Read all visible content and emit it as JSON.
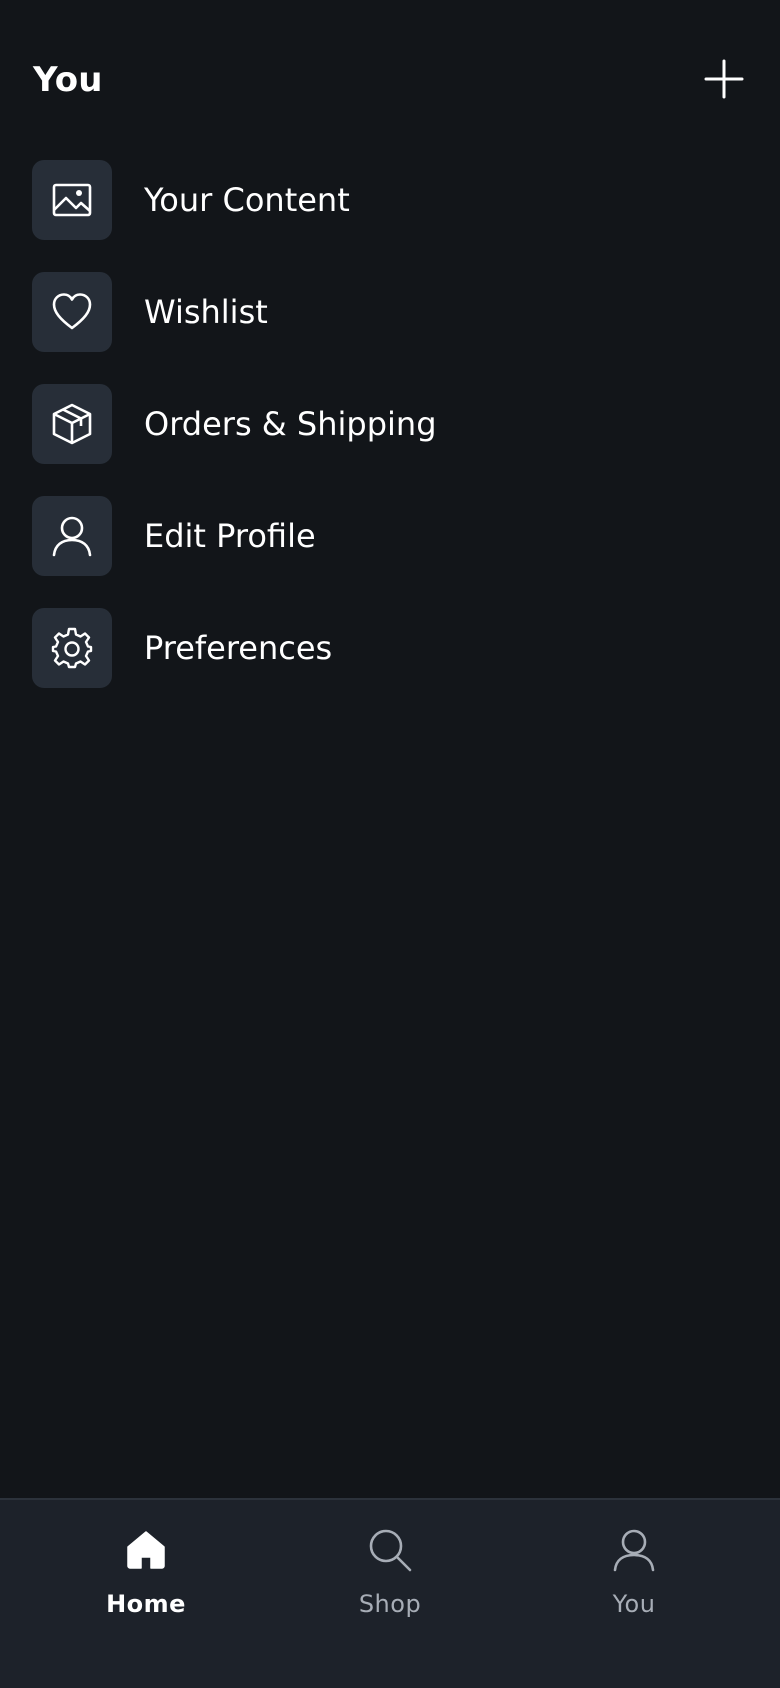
{
  "header": {
    "title": "You",
    "add_icon": "plus-icon"
  },
  "menu": {
    "items": [
      {
        "label": "Your Content",
        "icon": "image-icon"
      },
      {
        "label": "Wishlist",
        "icon": "heart-icon"
      },
      {
        "label": "Orders & Shipping",
        "icon": "package-icon"
      },
      {
        "label": "Edit Profile",
        "icon": "user-icon"
      },
      {
        "label": "Preferences",
        "icon": "gear-icon"
      }
    ]
  },
  "bottom_nav": {
    "tabs": [
      {
        "label": "Home",
        "icon": "home-icon",
        "active": true
      },
      {
        "label": "Shop",
        "icon": "search-icon",
        "active": false
      },
      {
        "label": "You",
        "icon": "user-icon",
        "active": false
      }
    ]
  },
  "colors": {
    "background": "#121519",
    "tile": "#272e38",
    "nav_background": "#1d222a",
    "nav_inactive": "#a7adb6",
    "text": "#ffffff"
  }
}
